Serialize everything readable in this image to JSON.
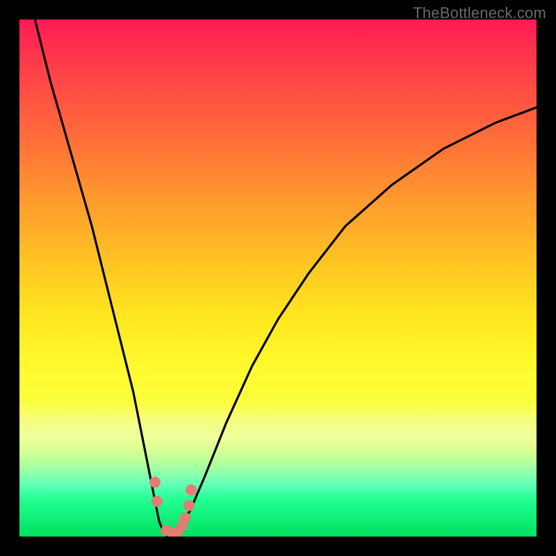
{
  "watermark": "TheBottleneck.com",
  "colors": {
    "frame_bg_top": "#ff1a55",
    "frame_bg_bottom": "#00e060",
    "curve_stroke": "#000000",
    "dot_fill": "#e37d73",
    "page_bg": "#000000"
  },
  "chart_data": {
    "type": "line",
    "title": "",
    "xlabel": "",
    "ylabel": "",
    "xlim": [
      0,
      100
    ],
    "ylim": [
      0,
      100
    ],
    "grid": false,
    "note": "Bottleneck-style curve. No axes or ticks shown; x approximates a normalized hardware-balance axis, y approximates bottleneck severity (0 = none, 100 = max). Values estimated from pixel positions.",
    "series": [
      {
        "name": "bottleneck-severity",
        "x": [
          3,
          6,
          10,
          14,
          18,
          22,
          24,
          26,
          27,
          28,
          29,
          30,
          31,
          33,
          36,
          40,
          45,
          50,
          56,
          63,
          72,
          82,
          92,
          100
        ],
        "y": [
          100,
          88,
          74,
          60,
          44,
          28,
          18,
          8,
          3,
          0.5,
          0,
          0.5,
          2,
          5,
          12,
          22,
          33,
          42,
          51,
          60,
          68,
          75,
          80,
          83
        ]
      }
    ],
    "scatter_points": {
      "name": "sample-configs",
      "x": [
        26.2,
        26.6,
        28.4,
        29.6,
        30.4,
        31.4,
        32.0,
        32.8,
        33.2
      ],
      "y": [
        10.5,
        6.8,
        1.2,
        0.6,
        0.8,
        2.0,
        3.6,
        6.0,
        9.0
      ]
    }
  }
}
